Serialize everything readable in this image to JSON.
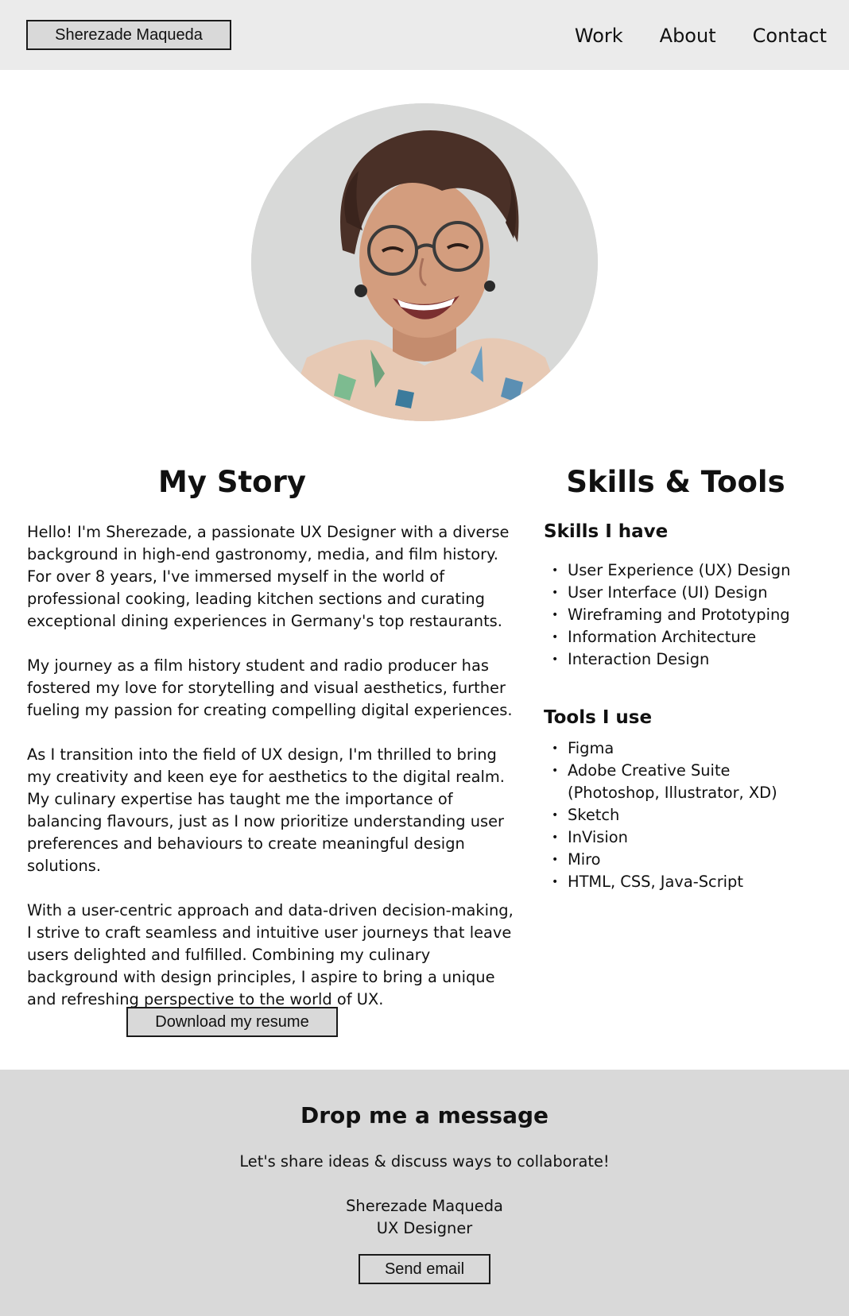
{
  "header": {
    "name_button": "Sherezade Maqueda",
    "nav": [
      "Work",
      "About",
      "Contact"
    ]
  },
  "profile_photo": {
    "icon": "portrait-photo",
    "background": "#d5d6d6"
  },
  "story": {
    "title": "My Story",
    "paragraphs": [
      "Hello! I'm Sherezade, a passionate UX Designer with a diverse background in high-end gastronomy, media, and film history. For over 8 years, I've immersed myself in the world of professional cooking, leading kitchen sections and curating exceptional dining experiences in Germany's top restaurants.",
      "My journey as a film history student and radio producer has fostered my love for storytelling and visual aesthetics, further fueling my passion for creating compelling digital experiences.",
      "As I transition into the field of UX design, I'm thrilled to bring my creativity and keen eye for aesthetics to the digital realm. My culinary expertise has taught me the importance of balancing flavours, just as I now prioritize understanding user preferences and behaviours to create meaningful design solutions.",
      "With a user-centric approach and data-driven decision-making, I strive to craft seamless and intuitive user journeys that leave users delighted and fulfilled. Combining my culinary background with design principles, I aspire to bring a unique and refreshing perspective to the world of UX."
    ],
    "resume_button": "Download my resume"
  },
  "skills": {
    "title": "Skills & Tools",
    "skills_heading": "Skills I have",
    "skills_list": [
      "User Experience (UX) Design",
      "User Interface (UI) Design",
      "Wireframing and Prototyping",
      "Information Architecture",
      "Interaction Design"
    ],
    "tools_heading": "Tools I use",
    "tools_list": [
      "Figma",
      "Adobe Creative Suite (Photoshop, Illustrator, XD)",
      "Sketch",
      "InVision",
      "Miro",
      "HTML, CSS, Java-Script"
    ]
  },
  "footer": {
    "title": "Drop me a message",
    "subtitle": "Let's share ideas & discuss ways to collaborate!",
    "name": "Sherezade Maqueda",
    "role": "UX Designer",
    "email_button": "Send email"
  },
  "colors": {
    "header_bg": "#ebebeb",
    "button_bg": "#d9d9d9",
    "footer_bg": "#d9d9d9",
    "text": "#111111"
  }
}
